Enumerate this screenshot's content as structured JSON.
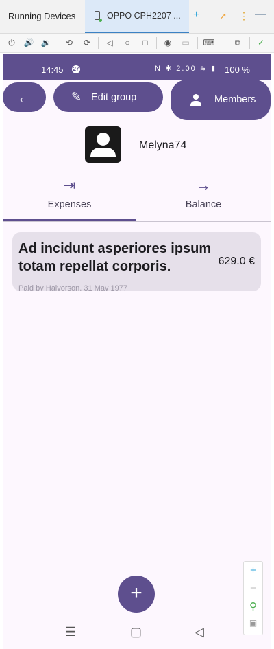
{
  "ide": {
    "panel_title": "Running Devices",
    "device_tab_label": "OPPO CPH2207 ...",
    "add_icon": "plus-icon",
    "expand_icon": "arrow-expand-icon",
    "more_icon": "kebab-icon",
    "minimize_icon": "minimize-icon"
  },
  "toolbar": {
    "icons": [
      "power-icon",
      "volume-up-icon",
      "volume-down-icon",
      "rotate-left-icon",
      "rotate-right-icon",
      "back-icon",
      "home-icon",
      "overview-icon",
      "screenshot-icon",
      "screenrecord-icon",
      "keyboard-icon",
      "snapshot-icon",
      "check-icon"
    ]
  },
  "statusbar": {
    "time": "14:45",
    "badge": "27",
    "net_speed": "2.00",
    "battery": "100 %"
  },
  "header": {
    "back_icon": "arrow-left-icon",
    "edit_label": "Edit group",
    "members_label": "Members"
  },
  "group": {
    "name": "Melyna74"
  },
  "tabs": [
    {
      "label": "Expenses",
      "icon": "login-icon",
      "selected": true
    },
    {
      "label": "Balance",
      "icon": "arrow-right-icon",
      "selected": false
    }
  ],
  "expenses": [
    {
      "title": "Ad incidunt asperiores ipsum totam repellat corporis.",
      "amount": "629.0 €",
      "subtitle": "Paid by Halvorson, 31 May 1977"
    }
  ],
  "fab_label": "+",
  "colors": {
    "primary": "#5e4f8e",
    "background": "#fdf7fe",
    "card": "#e6e0ea"
  }
}
